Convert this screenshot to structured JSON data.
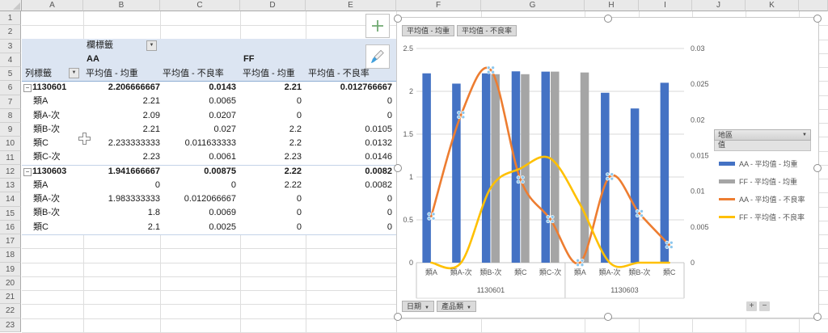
{
  "sheet": {
    "column_headers": [
      "A",
      "B",
      "C",
      "D",
      "E",
      "F",
      "G",
      "H",
      "I",
      "J",
      "K",
      ""
    ],
    "row_count": 23
  },
  "pivot": {
    "column_label": "欄標籤",
    "row_label": "列標籤",
    "group_headers": {
      "aa": "AA",
      "ff": "FF"
    },
    "value_headers": [
      "平均值 - 均重",
      "平均值 - 不良率",
      "平均值 - 均重",
      "平均值 - 不良率"
    ],
    "rows": [
      {
        "label": "1130601",
        "type": "group",
        "values": [
          "2.206666667",
          "0.0143",
          "2.21",
          "0.012766667"
        ]
      },
      {
        "label": "類A",
        "type": "item",
        "values": [
          "2.21",
          "0.0065",
          "0",
          "0"
        ]
      },
      {
        "label": "類A-次",
        "type": "item",
        "values": [
          "2.09",
          "0.0207",
          "0",
          "0"
        ]
      },
      {
        "label": "類B-次",
        "type": "item",
        "values": [
          "2.21",
          "0.027",
          "2.2",
          "0.0105"
        ]
      },
      {
        "label": "類C",
        "type": "item",
        "values": [
          "2.233333333",
          "0.011633333",
          "2.2",
          "0.0132"
        ]
      },
      {
        "label": "類C-次",
        "type": "item",
        "values": [
          "2.23",
          "0.0061",
          "2.23",
          "0.0146"
        ]
      },
      {
        "label": "1130603",
        "type": "group",
        "values": [
          "1.941666667",
          "0.00875",
          "2.22",
          "0.0082"
        ]
      },
      {
        "label": "類A",
        "type": "item",
        "values": [
          "0",
          "0",
          "2.22",
          "0.0082"
        ]
      },
      {
        "label": "類A-次",
        "type": "item",
        "values": [
          "1.983333333",
          "0.012066667",
          "0",
          "0"
        ]
      },
      {
        "label": "類B-次",
        "type": "item",
        "values": [
          "1.8",
          "0.0069",
          "0",
          "0"
        ]
      },
      {
        "label": "類C",
        "type": "item",
        "values": [
          "2.1",
          "0.0025",
          "0",
          "0"
        ]
      }
    ]
  },
  "chart": {
    "type": "combo-bar-line-pivotchart",
    "value_buttons": [
      "平均值 - 均重",
      "平均值 - 不良率"
    ],
    "axis_buttons": [
      "日期",
      "產品類"
    ],
    "legend_field": "地區",
    "legend_value": "值",
    "zoom_in": "+",
    "zoom_out": "−",
    "left_axis": {
      "labels": [
        "0",
        "0.5",
        "1",
        "1.5",
        "2",
        "2.5"
      ],
      "values": [
        0,
        0.5,
        1,
        1.5,
        2,
        2.5
      ],
      "max": 2.5
    },
    "right_axis": {
      "labels": [
        "0",
        "0.005",
        "0.01",
        "0.015",
        "0.02",
        "0.025",
        "0.03"
      ],
      "values": [
        0,
        0.005,
        0.01,
        0.015,
        0.02,
        0.025,
        0.03
      ],
      "max": 0.03
    },
    "groups": [
      {
        "label": "1130601",
        "categories": [
          "類A",
          "類A-次",
          "類B-次",
          "類C",
          "類C-次"
        ]
      },
      {
        "label": "1130603",
        "categories": [
          "類A",
          "類A-次",
          "類B-次",
          "類C"
        ]
      }
    ],
    "series": [
      {
        "name": "AA - 平均值 - 均重",
        "type": "bar",
        "axis": "left",
        "color": "#4472C4",
        "values": [
          2.21,
          2.09,
          2.21,
          2.233333333,
          2.23,
          0,
          1.983333333,
          1.8,
          2.1
        ]
      },
      {
        "name": "FF - 平均值 - 均重",
        "type": "bar",
        "axis": "left",
        "color": "#A5A5A5",
        "values": [
          0,
          0,
          2.2,
          2.2,
          2.23,
          2.22,
          0,
          0,
          0
        ]
      },
      {
        "name": "AA - 平均值 - 不良率",
        "type": "line",
        "axis": "right",
        "color": "#ED7D31",
        "selected": true,
        "values": [
          0.0065,
          0.0207,
          0.027,
          0.011633333,
          0.0061,
          0,
          0.012066667,
          0.0069,
          0.0025
        ]
      },
      {
        "name": "FF - 平均值 - 不良率",
        "type": "line",
        "axis": "right",
        "color": "#FFC000",
        "selected": false,
        "values": [
          0,
          0,
          0.0105,
          0.0132,
          0.0146,
          0.0082,
          0,
          0,
          0
        ]
      }
    ],
    "marker_color": "#8CC7EE"
  }
}
